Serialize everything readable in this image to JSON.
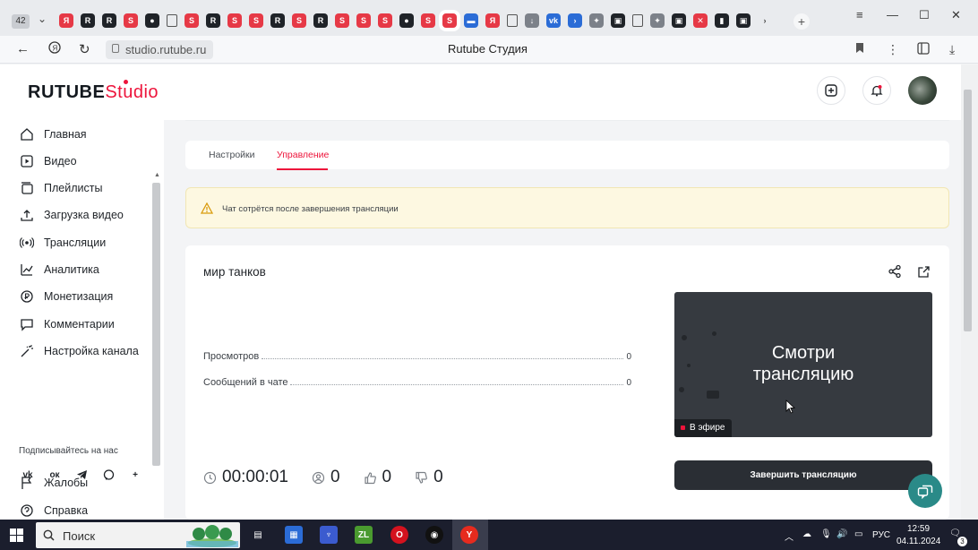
{
  "browser": {
    "tab_count": "42",
    "url": "studio.rutube.ru",
    "page_title": "Rutube Студия",
    "new_tab": "+"
  },
  "app": {
    "logo_main": "RUTUBE",
    "logo_accent": "Studio",
    "brand_color": "#ed143b"
  },
  "sidebar": {
    "items": [
      {
        "label": "Главная",
        "icon": "home-icon"
      },
      {
        "label": "Видео",
        "icon": "video-icon"
      },
      {
        "label": "Плейлисты",
        "icon": "playlist-icon"
      },
      {
        "label": "Загрузка видео",
        "icon": "upload-icon"
      },
      {
        "label": "Трансляции",
        "icon": "broadcast-icon"
      },
      {
        "label": "Аналитика",
        "icon": "analytics-icon"
      },
      {
        "label": "Монетизация",
        "icon": "monetization-icon"
      },
      {
        "label": "Комментарии",
        "icon": "comments-icon"
      },
      {
        "label": "Настройка канала",
        "icon": "channel-settings-icon"
      }
    ],
    "subscribe_label": "Подписывайтесь на нас",
    "socials": [
      "vk-icon",
      "ok-icon",
      "telegram-icon",
      "viber-icon",
      "plus-icon"
    ],
    "bottom_items": [
      {
        "label": "Жалобы",
        "icon": "complaints-icon"
      },
      {
        "label": "Справка",
        "icon": "help-icon"
      }
    ]
  },
  "tabs": [
    {
      "label": "Настройки",
      "active": false
    },
    {
      "label": "Управление",
      "active": true
    }
  ],
  "notice": {
    "text": "Чат сотрётся после завершения трансляции"
  },
  "stream": {
    "title": "мир танков",
    "stats": [
      {
        "label": "Просмотров",
        "value": "0"
      },
      {
        "label": "Сообщений в чате",
        "value": "0"
      }
    ],
    "duration": "00:00:01",
    "viewers": "0",
    "likes": "0",
    "dislikes": "0",
    "player_text_line1": "Смотри",
    "player_text_line2": "трансляцию",
    "live_badge": "В эфире",
    "end_button": "Завершить трансляцию"
  },
  "taskbar": {
    "search_placeholder": "Поиск",
    "lang": "РУС",
    "time": "12:59",
    "date": "04.11.2024",
    "notifications": "3"
  }
}
